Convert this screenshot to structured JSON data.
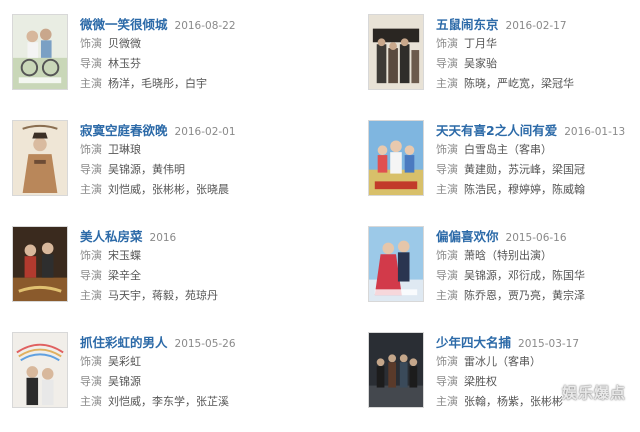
{
  "labels": {
    "role": "饰演",
    "director": "导演",
    "cast": "主演"
  },
  "colors": {
    "title": "#2c6aa8",
    "date": "#8a8a8a",
    "label": "#8a8a8a",
    "text": "#555555"
  },
  "items": [
    {
      "poster_icon": "poster-love-o2o",
      "title": "微微一笑很倾城",
      "date": "2016-08-22",
      "role": "贝微微",
      "director": "林玉芬",
      "cast": "杨洋，毛晓彤，白宇"
    },
    {
      "poster_icon": "poster-five-rats",
      "title": "五鼠闹东京",
      "date": "2016-02-17",
      "role": "丁月华",
      "director": "吴家骀",
      "cast": "陈晓，严屹宽，梁冠华"
    },
    {
      "poster_icon": "poster-lonely-courtyard",
      "title": "寂寞空庭春欲晚",
      "date": "2016-02-01",
      "role": "卫琳琅",
      "director": "吴锦源，黄伟明",
      "cast": "刘恺威，张彬彬，张晓晨"
    },
    {
      "poster_icon": "poster-happy-everyday",
      "title": "天天有喜2之人间有爱",
      "date": "2016-01-13",
      "role": "白雪岛主（客串）",
      "director": "黄建勋，苏沅峰，梁国冠",
      "cast": "陈浩民，穆婷婷，陈威翰"
    },
    {
      "poster_icon": "poster-beauty-kitchen",
      "title": "美人私房菜",
      "date": "2016",
      "role": "宋玉蝶",
      "director": "梁辛全",
      "cast": "马天宇，蒋毅，苑琼丹"
    },
    {
      "poster_icon": "poster-just-like-you",
      "title": "偏偏喜欢你",
      "date": "2015-06-16",
      "role": "萧晗（特别出演）",
      "director": "吴锦源，邓衍成，陈国华",
      "cast": "陈乔恩，贾乃亮，黄宗泽"
    },
    {
      "poster_icon": "poster-rainbow-man",
      "title": "抓住彩虹的男人",
      "date": "2015-05-26",
      "role": "吴彩虹",
      "director": "吴锦源",
      "cast": "刘恺威，李东学，张芷溪"
    },
    {
      "poster_icon": "poster-four-detectives",
      "title": "少年四大名捕",
      "date": "2015-03-17",
      "role": "雷冰儿（客串）",
      "director": "梁胜权",
      "cast": "",
      "cast_obscured": "张翰，杨紫，张彬彬"
    }
  ],
  "watermark": "娱乐爆点"
}
